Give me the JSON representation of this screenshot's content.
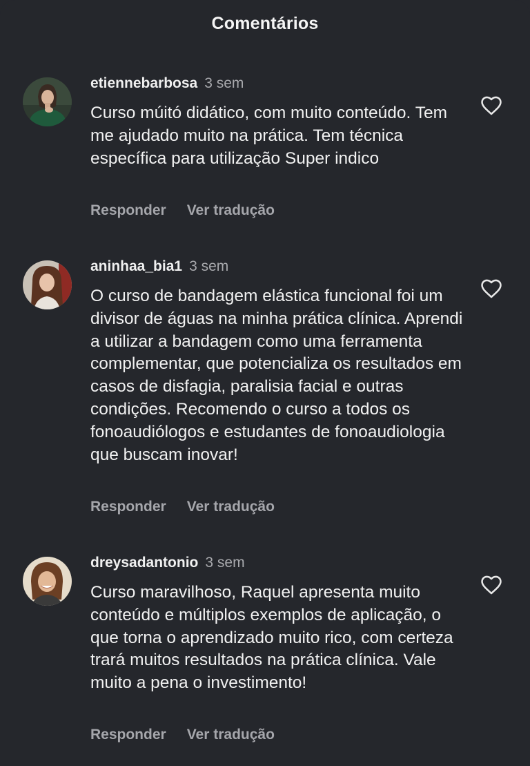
{
  "header": {
    "title": "Comentários"
  },
  "colors": {
    "background": "#25272c",
    "text": "#f1f1f1",
    "muted": "#a5a6ab"
  },
  "comments": [
    {
      "username": "etiennebarbosa",
      "time": "3 sem",
      "text": "Curso múitó didático, com muito conteúdo. Tem  me ajudado muito na prática. Tem técnica específica para utilização  Super indico",
      "reply_label": "Responder",
      "translate_label": "Ver tradução",
      "like_icon": "heart-outline-icon"
    },
    {
      "username": "aninhaa_bia1",
      "time": "3 sem",
      "text": "O curso de bandagem elástica funcional foi um divisor de águas na minha prática clínica. Aprendi a utilizar a bandagem como uma ferramenta complementar, que potencializa os resultados em casos de disfagia, paralisia facial e outras condições. Recomendo o curso a todos os fonoaudiólogos e estudantes de fonoaudiologia que buscam inovar!",
      "reply_label": "Responder",
      "translate_label": "Ver tradução",
      "like_icon": "heart-outline-icon"
    },
    {
      "username": "dreysadantonio",
      "time": "3 sem",
      "text": "Curso maravilhoso, Raquel apresenta muito conteúdo e múltiplos exemplos de aplicação, o que torna o aprendizado muito rico, com certeza trará muitos resultados na prática clínica. Vale muito a pena o investimento!",
      "reply_label": "Responder",
      "translate_label": "Ver tradução",
      "like_icon": "heart-outline-icon"
    }
  ]
}
